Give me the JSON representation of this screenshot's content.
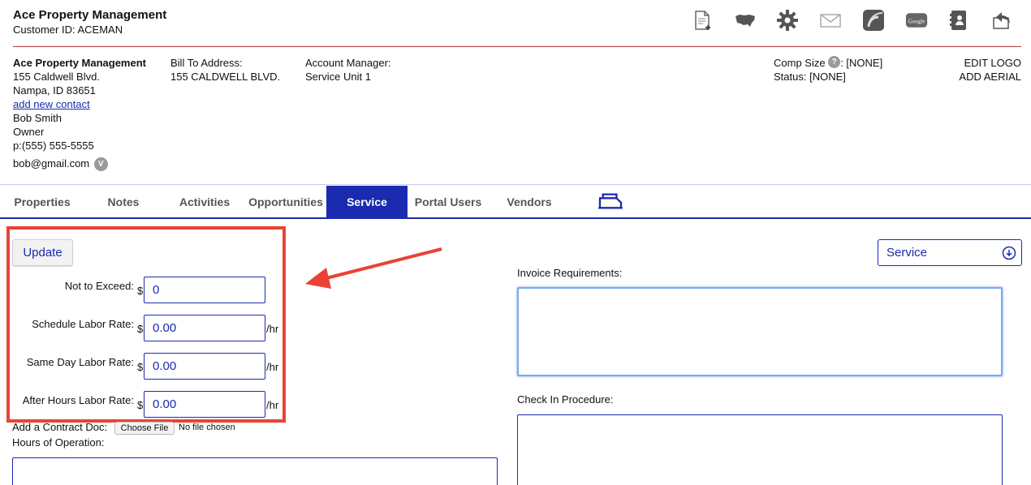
{
  "header": {
    "company_name": "Ace Property Management",
    "customer_id": "Customer ID: ACEMAN",
    "icons": [
      "add-document-icon",
      "usa-map-icon",
      "gear-icon",
      "mail-icon",
      "rss-feed-icon",
      "google-icon",
      "address-book-icon",
      "back-reply-icon"
    ],
    "google_text": "Google"
  },
  "customer": {
    "name": "Ace Property Management",
    "address1": "155 Caldwell Blvd.",
    "address2": "Nampa,  ID 83651",
    "add_contact": "add new contact",
    "contact_name": "Bob Smith",
    "contact_title": "Owner",
    "phone": "p:(555) 555-5555",
    "email": "bob@gmail.com",
    "v_badge": "V"
  },
  "billing": {
    "label": "Bill To Address:",
    "address": "155 CALDWELL BLVD."
  },
  "account": {
    "label": "Account Manager:",
    "value": "Service Unit 1"
  },
  "comp": {
    "comp_size_label": "Comp Size",
    "help": "?",
    "comp_size_value": ": [NONE]",
    "status": "Status: [NONE]"
  },
  "links": {
    "edit_logo": "EDIT LOGO",
    "add_aerial": "ADD AERIAL"
  },
  "tabs": [
    {
      "label": "Properties",
      "active": false
    },
    {
      "label": "Notes",
      "active": false
    },
    {
      "label": "Activities",
      "active": false
    },
    {
      "label": "Opportunities",
      "active": false
    },
    {
      "label": "Service",
      "active": true
    },
    {
      "label": "Portal Users",
      "active": false
    },
    {
      "label": "Vendors",
      "active": false
    }
  ],
  "service_form": {
    "update_label": "Update",
    "currency": "$",
    "per_hour": "/hr",
    "rates": [
      {
        "label": "Not to Exceed:",
        "value": "0"
      },
      {
        "label": "Schedule Labor Rate:",
        "value": "0.00"
      },
      {
        "label": "Same Day Labor Rate:",
        "value": "0.00"
      },
      {
        "label": "After Hours Labor Rate:",
        "value": "0.00"
      }
    ],
    "contract_doc_label": "Add a Contract Doc:",
    "choose_file": "Choose File",
    "no_file": "No file chosen",
    "hours_label": "Hours of Operation:",
    "dropdown_value": "Service",
    "invoice_label": "Invoice Requirements:",
    "checkin_label": "Check In Procedure:"
  },
  "colors": {
    "accent": "#1a2bb0",
    "highlight": "#ea4335",
    "header_rule": "#b23a3a"
  }
}
